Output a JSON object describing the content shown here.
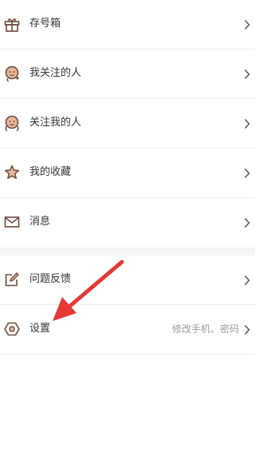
{
  "menu_group_1": [
    {
      "label": "存号箱",
      "icon": "gift-icon"
    },
    {
      "label": "我关注的人",
      "icon": "user-following-icon"
    },
    {
      "label": "关注我的人",
      "icon": "user-followers-icon"
    },
    {
      "label": "我的收藏",
      "icon": "star-icon"
    },
    {
      "label": "消息",
      "icon": "mail-icon"
    }
  ],
  "menu_group_2": [
    {
      "label": "问题反馈",
      "icon": "edit-icon"
    },
    {
      "label": "设置",
      "icon": "hexagon-settings-icon",
      "subtitle": "修改手机、密码"
    }
  ],
  "colors": {
    "icon_stroke": "#6b4a3a",
    "icon_accent": "#e8b89a",
    "annotation_arrow": "#e53935",
    "chevron": "#555555"
  }
}
